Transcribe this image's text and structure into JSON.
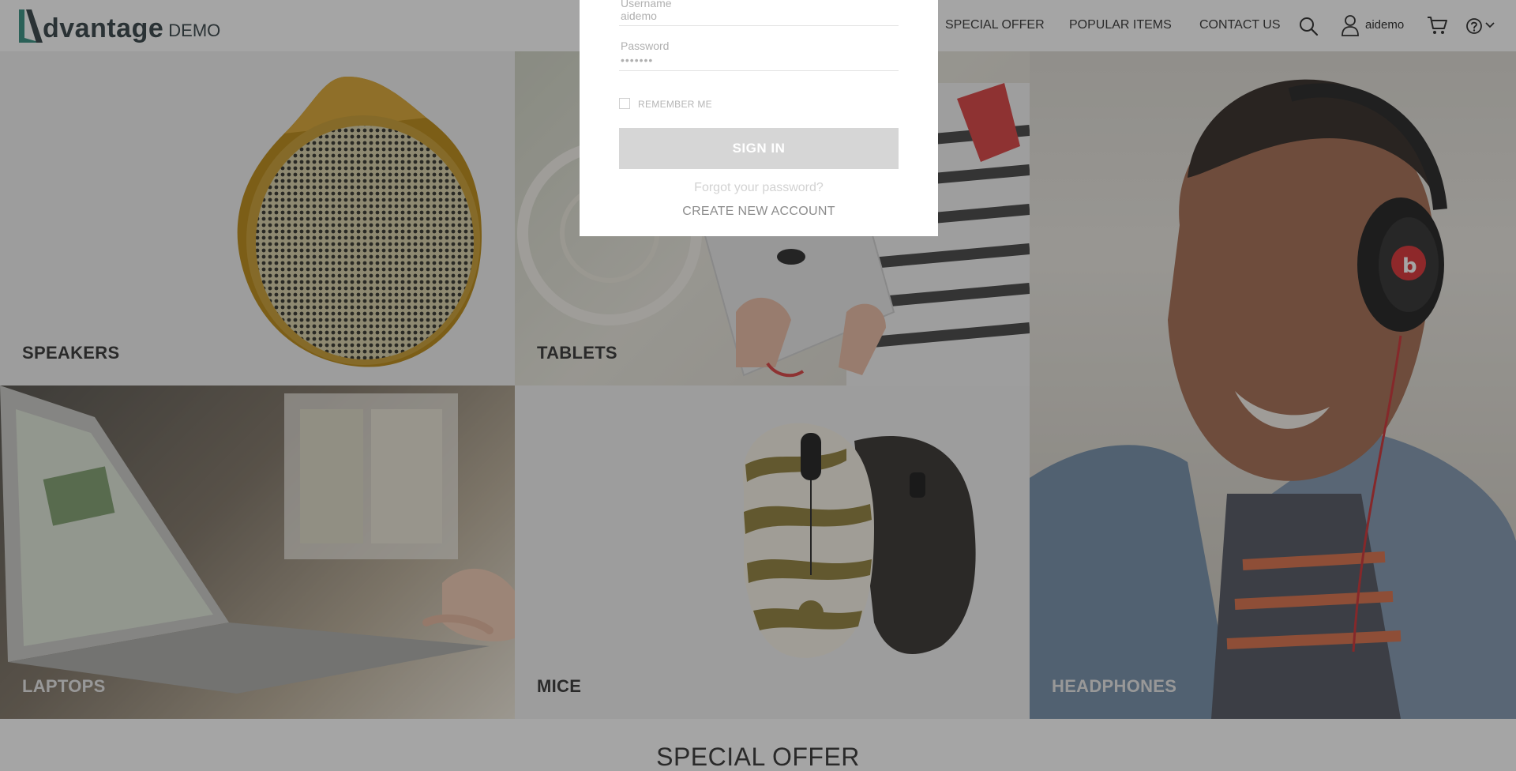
{
  "header": {
    "logo": {
      "word": "dvantage",
      "suffix": "DEMO"
    },
    "nav": {
      "special_offer": "SPECIAL OFFER",
      "popular_items": "POPULAR ITEMS",
      "contact_us": "CONTACT US"
    },
    "user": {
      "name": "aidemo"
    },
    "icons": [
      "search-icon",
      "user-icon",
      "cart-icon",
      "help-icon",
      "chevron-down-icon"
    ]
  },
  "categories": {
    "speakers": "SPEAKERS",
    "tablets": "TABLETS",
    "headphones": "HEADPHONES",
    "laptops": "LAPTOPS",
    "mice": "MICE"
  },
  "special_offer": {
    "title": "SPECIAL OFFER"
  },
  "login": {
    "username_label": "Username",
    "username_value": "aidemo",
    "password_label": "Password",
    "password_value": "•••••••",
    "remember_me": "REMEMBER ME",
    "sign_in": "SIGN IN",
    "forgot_password": "Forgot your password?",
    "create_account": "CREATE NEW ACCOUNT"
  },
  "colors": {
    "brand": "#2b3a3e",
    "logo_accent": "#2e8b7a",
    "overlay": "rgba(40,40,40,0.42)",
    "signin_button": "#d6d6d6"
  }
}
